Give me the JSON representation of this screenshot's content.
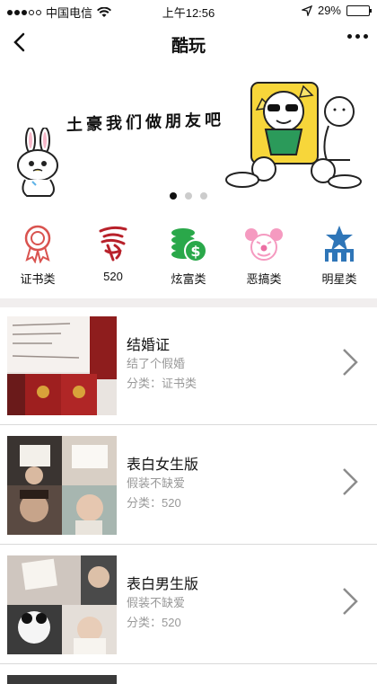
{
  "status": {
    "carrier": "中国电信",
    "time": "上午12:56",
    "battery": "29%",
    "battery_level": 0.29
  },
  "nav": {
    "title": "酷玩"
  },
  "banner": {
    "text": "土豪我们做朋友吧",
    "active_index": 0
  },
  "categories": [
    {
      "label": "证书类",
      "icon": "award-ribbon-icon",
      "color": "#d9534f"
    },
    {
      "label": "520",
      "icon": "love-calligraphy-icon",
      "color": "#b8212a"
    },
    {
      "label": "炫富类",
      "icon": "money-coins-icon",
      "color": "#2aa84a"
    },
    {
      "label": "恶搞类",
      "icon": "clown-face-icon",
      "color": "#ec6fa3"
    },
    {
      "label": "明星类",
      "icon": "star-building-icon",
      "color": "#2f76b8"
    }
  ],
  "items": [
    {
      "name": "结婚证",
      "subtitle": "结了个假婚",
      "category": "分类：证书类"
    },
    {
      "name": "表白女生版",
      "subtitle": "假装不缺爱",
      "category": "分类：520"
    },
    {
      "name": "表白男生版",
      "subtitle": "假装不缺爱",
      "category": "分类：520"
    }
  ]
}
